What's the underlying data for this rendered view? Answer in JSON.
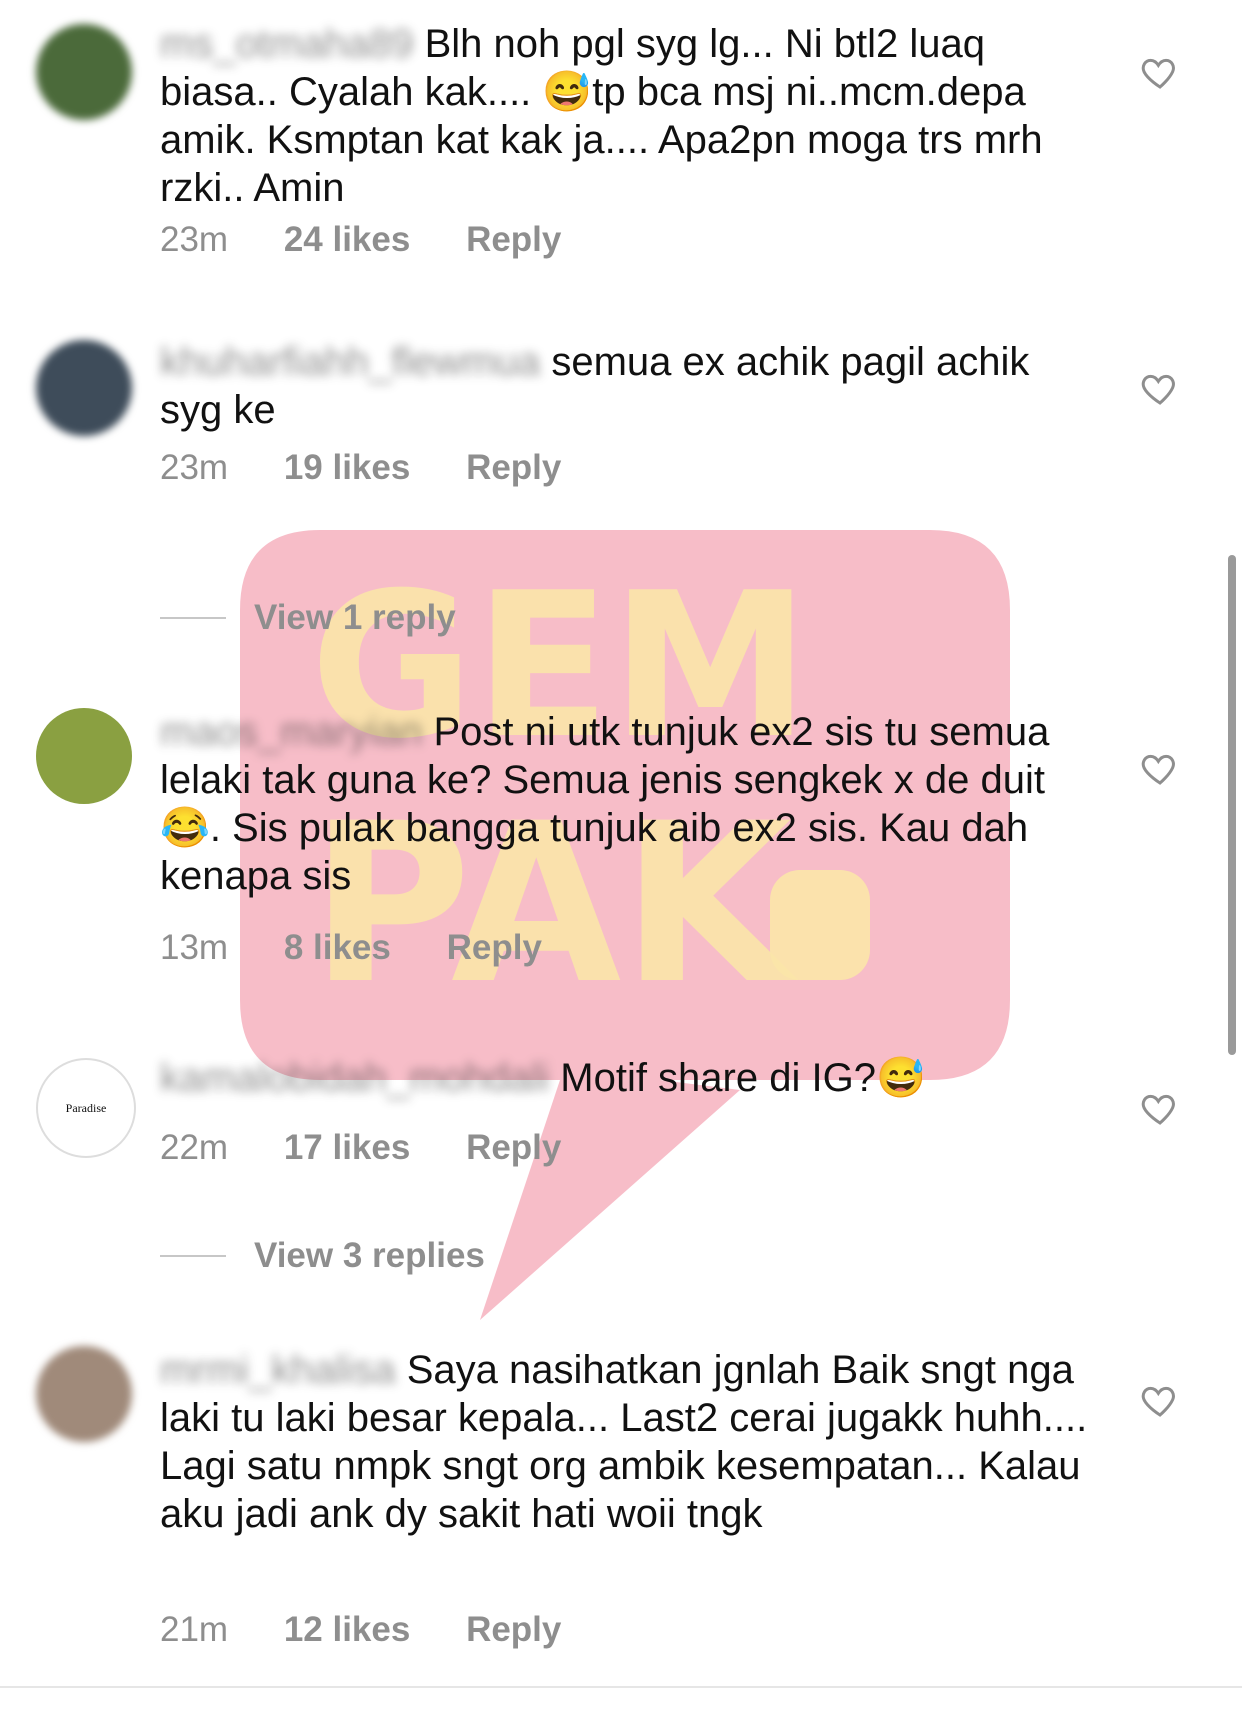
{
  "comments": [
    {
      "username": "ms_otmaha89",
      "text": "Blh noh pgl syg lg... Ni btl2 luaq biasa.. Cyalah kak.... ",
      "emoji": "😅",
      "text2": "tp bca msj ni..mcm.depa amik. Ksmptan kat kak ja.... Apa2pn moga trs mrh rzki.. Amin",
      "time": "23m",
      "likes": "24 likes",
      "reply": "Reply",
      "avatar_color": "#4b6a3a"
    },
    {
      "username": "khuharfiahh_flewmua",
      "text": "semua ex achik pagil achik syg ke",
      "time": "23m",
      "likes": "19 likes",
      "reply": "Reply",
      "view_replies": "View 1 reply",
      "avatar_color": "#3e4c5a"
    },
    {
      "username": "maos_maryian",
      "text": "Post ni utk tunjuk ex2 sis tu semua lelaki tak guna ke? Semua jenis sengkek x de duit",
      "emoji": "😂",
      "text2": ". Sis pulak bangga tunjuk aib ex2 sis. Kau dah kenapa sis",
      "time": "13m",
      "likes": "8 likes",
      "reply": "Reply",
      "avatar_color": "#8aa041"
    },
    {
      "username": "kamalobidah_mohdali",
      "text": "Motif share di IG?",
      "emoji": "😅",
      "time": "22m",
      "likes": "17 likes",
      "reply": "Reply",
      "view_replies": "View 3 replies",
      "avatar_label": "Paradise",
      "avatar_color": "#ffffff"
    },
    {
      "username": "mrmi_khalisa",
      "text": "Saya nasihatkan jgnlah Baik sngt nga laki tu laki besar kepala... Last2 cerai jugakk huhh.... Lagi satu nmpk sngt org ambik kesempatan... Kalau aku jadi ank dy sakit hati woii tngk",
      "time": "21m",
      "likes": "12 likes",
      "reply": "Reply",
      "avatar_color": "#a08a7a"
    }
  ],
  "watermark": {
    "line1": "GEM",
    "line2": "PAK",
    "bubble_color": "#f4a7b5",
    "text_color": "#fbe6a9"
  }
}
